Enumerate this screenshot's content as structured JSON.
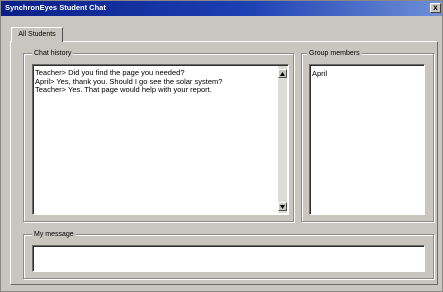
{
  "window": {
    "title": "SynchronEyes Student Chat",
    "close_label": "x"
  },
  "tabs": [
    {
      "label": "All Students",
      "selected": true
    }
  ],
  "chat_history": {
    "label": "Chat history",
    "lines": [
      "Teacher> Did you find the page you needed?",
      "April> Yes, thank you. Should I go see the solar system?",
      "Teacher> Yes. That page would help with your report."
    ]
  },
  "group_members": {
    "label": "Group members",
    "members": [
      "April"
    ]
  },
  "my_message": {
    "label": "My message",
    "value": ""
  },
  "icons": {
    "scroll_up": "arrow-up-icon",
    "scroll_down": "arrow-down-icon"
  }
}
